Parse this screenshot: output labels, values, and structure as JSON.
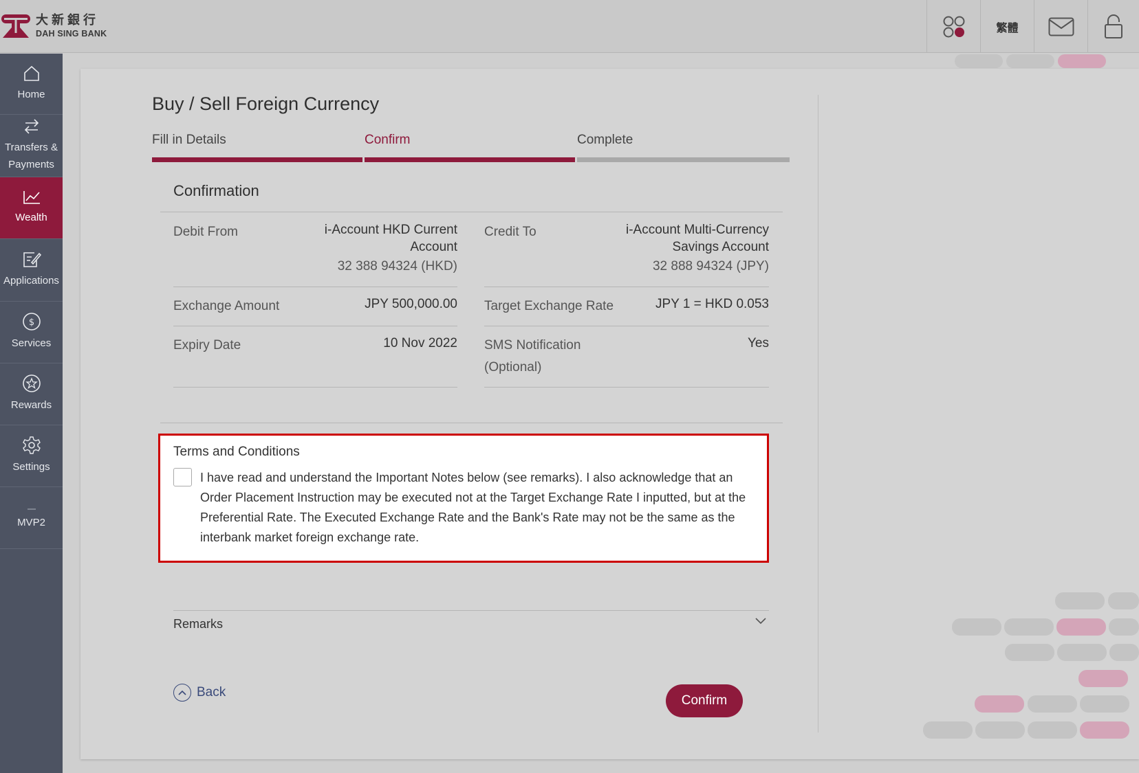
{
  "header": {
    "brand_cn": "大新銀行",
    "brand_en": "DAH SING BANK",
    "language_label": "繁體",
    "icons": [
      "apps-icon",
      "mail-icon",
      "lock-icon"
    ]
  },
  "sidebar": {
    "items": [
      {
        "label": "Home",
        "icon": "home-icon"
      },
      {
        "label": "Transfers & Payments",
        "icon": "transfer-icon"
      },
      {
        "label": "Wealth",
        "icon": "chart-icon",
        "active": true
      },
      {
        "label": "Applications",
        "icon": "edit-icon"
      },
      {
        "label": "Services",
        "icon": "dollar-icon"
      },
      {
        "label": "Rewards",
        "icon": "star-icon"
      },
      {
        "label": "Settings",
        "icon": "gear-icon"
      },
      {
        "label": "MVP2",
        "icon": "dash-icon"
      }
    ]
  },
  "page": {
    "title": "Buy / Sell Foreign Currency",
    "steps": [
      "Fill in Details",
      "Confirm",
      "Complete"
    ],
    "current_step": 2
  },
  "confirmation": {
    "title": "Confirmation",
    "debit_from": {
      "label": "Debit From",
      "line1": "i-Account HKD Current",
      "line2": "Account",
      "line3": "32 388 94324 (HKD)"
    },
    "credit_to": {
      "label": "Credit To",
      "line1": "i-Account Multi-Currency",
      "line2": "Savings Account",
      "line3": "32 888 94324 (JPY)"
    },
    "exchange_amount": {
      "label": "Exchange Amount",
      "value": "JPY 500,000.00"
    },
    "target_rate": {
      "label": "Target Exchange Rate",
      "value": "JPY 1 = HKD 0.053"
    },
    "expiry_date": {
      "label": "Expiry Date",
      "value": "10 Nov 2022"
    },
    "sms": {
      "label_line1": "SMS Notification",
      "label_line2": "(Optional)",
      "value": "Yes"
    }
  },
  "terms": {
    "title": "Terms and Conditions",
    "text": "I have read and understand the Important Notes below (see remarks). I also acknowledge that an Order Placement Instruction may be executed not at the Target Exchange Rate I inputted, but at the Preferential Rate. The Executed Exchange Rate and the Bank's Rate may not be the same as the interbank market foreign exchange rate.",
    "checked": false
  },
  "remarks": {
    "label": "Remarks"
  },
  "actions": {
    "back_label": "Back",
    "confirm_label": "Confirm"
  },
  "colors": {
    "brand": "#8e1a3c",
    "sidebar": "#4d5362",
    "terms_border": "#cc0000",
    "step_inactive": "#a9a9a9"
  }
}
